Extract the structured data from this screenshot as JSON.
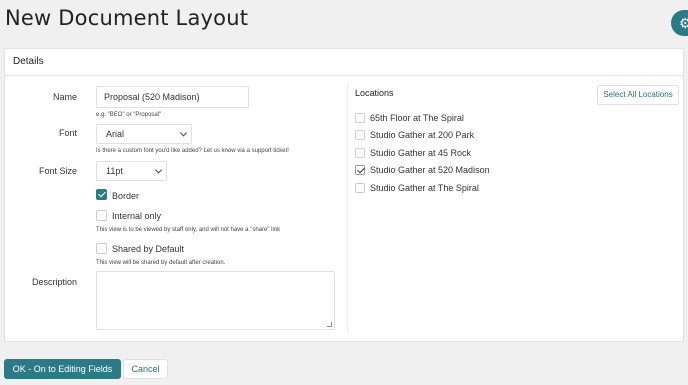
{
  "header": {
    "title": "New Document Layout"
  },
  "card": {
    "title": "Details"
  },
  "form": {
    "name_label": "Name",
    "name_value": "Proposal (520 Madison)",
    "name_help": "e.g. \"BEO\" or \"Proposal\"",
    "font_label": "Font",
    "font_value": "Arial",
    "font_help": "Is there a custom font you'd like added? Let us know via a support ticket!",
    "font_size_label": "Font Size",
    "font_size_value": "11pt",
    "border_label": "Border",
    "border_checked": true,
    "internal_label": "Internal only",
    "internal_checked": false,
    "internal_help": "This view is to be viewed by staff only, and will not have a \"share\" link",
    "shared_label": "Shared by Default",
    "shared_checked": false,
    "shared_help": "This view will be shared by default after creation.",
    "description_label": "Description",
    "description_value": ""
  },
  "locations": {
    "title": "Locations",
    "select_all_label": "Select All Locations",
    "items": [
      {
        "label": "65th Floor at The Spiral",
        "checked": false
      },
      {
        "label": "Studio Gather at 200 Park",
        "checked": false
      },
      {
        "label": "Studio Gather at 45 Rock",
        "checked": false
      },
      {
        "label": "Studio Gather at 520 Madison",
        "checked": true
      },
      {
        "label": "Studio Gather at The Spiral",
        "checked": false
      }
    ]
  },
  "footer": {
    "ok_label": "OK - On to Editing Fields",
    "cancel_label": "Cancel"
  },
  "colors": {
    "accent": "#2d7a87",
    "link": "#2d6f7c"
  },
  "icons": {
    "settings": "gear-icon",
    "dropdown": "chevron-down-icon",
    "check": "check-icon"
  }
}
